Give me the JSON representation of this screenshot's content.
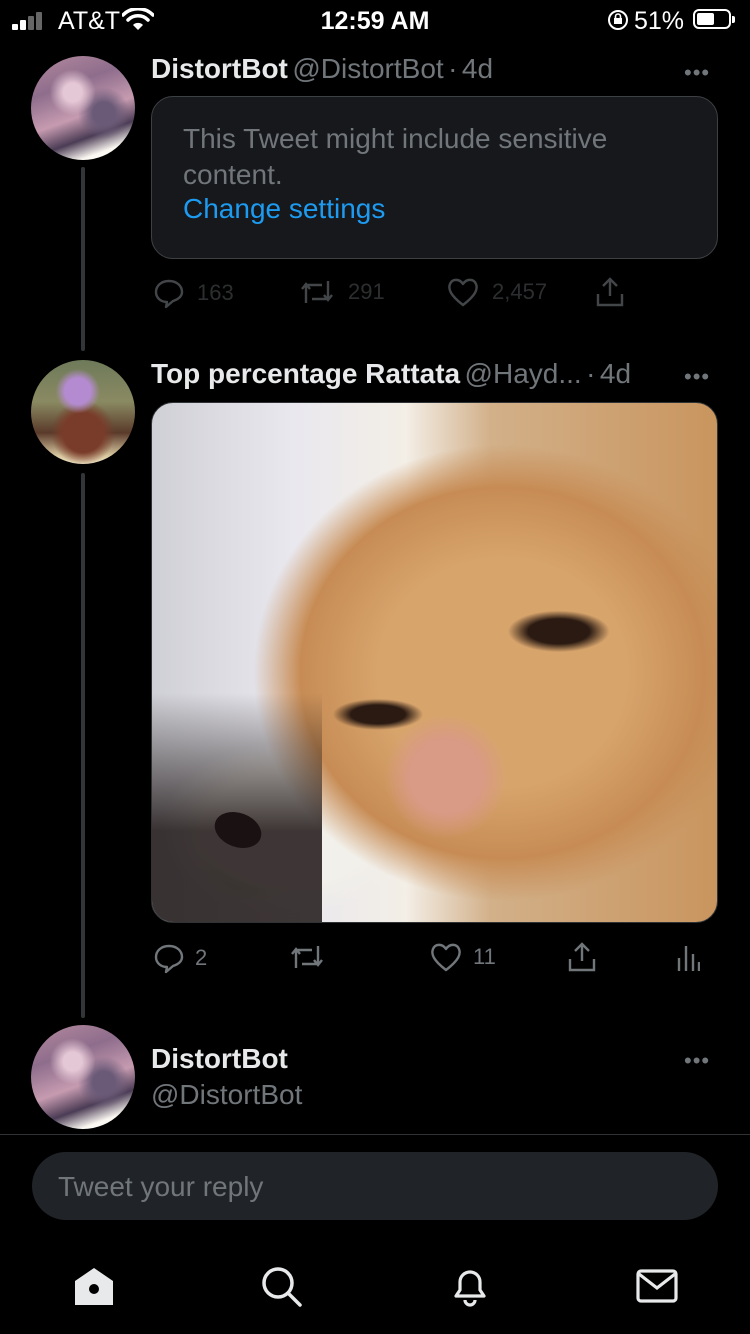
{
  "status_bar": {
    "carrier": "AT&T",
    "time": "12:59 AM",
    "battery_percent": "51%",
    "battery_level": 0.51
  },
  "tweets": [
    {
      "name": "DistortBot",
      "handle": "@DistortBot",
      "separator": "·",
      "age": "4d",
      "sensitive_message": "This Tweet might include sensitive content.",
      "change_settings": "Change settings",
      "replies": "163",
      "retweets": "291",
      "likes": "2,457"
    },
    {
      "name": "Top percentage Rattata",
      "handle": "@Hayd...",
      "separator": "·",
      "age": "4d",
      "replies": "2",
      "likes": "11"
    }
  ],
  "compose": {
    "name": "DistortBot",
    "handle": "@DistortBot"
  },
  "reply_input": {
    "placeholder": "Tweet your reply"
  },
  "tabbar": {
    "icons": [
      "home-icon",
      "search-icon",
      "notifications-icon",
      "messages-icon"
    ]
  },
  "colors": {
    "background": "#000000",
    "accent": "#1d9bf0",
    "secondary_text": "#71767b"
  }
}
